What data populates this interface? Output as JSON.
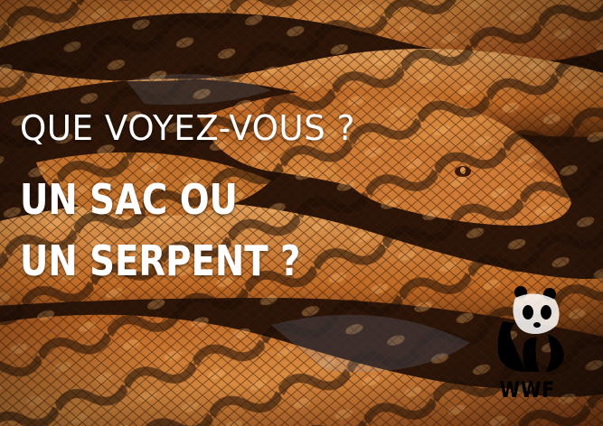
{
  "headline": {
    "line1": "QUE VOYEZ-VOUS ?",
    "line2": "UN SAC OU",
    "line3": "UN SERPENT ?"
  },
  "logo": {
    "text": "WWF",
    "icon": "panda-icon"
  },
  "colors": {
    "text": "#ffffff",
    "logo": "#000000",
    "scale_orange": "#c86a24",
    "scale_dark": "#241208"
  }
}
